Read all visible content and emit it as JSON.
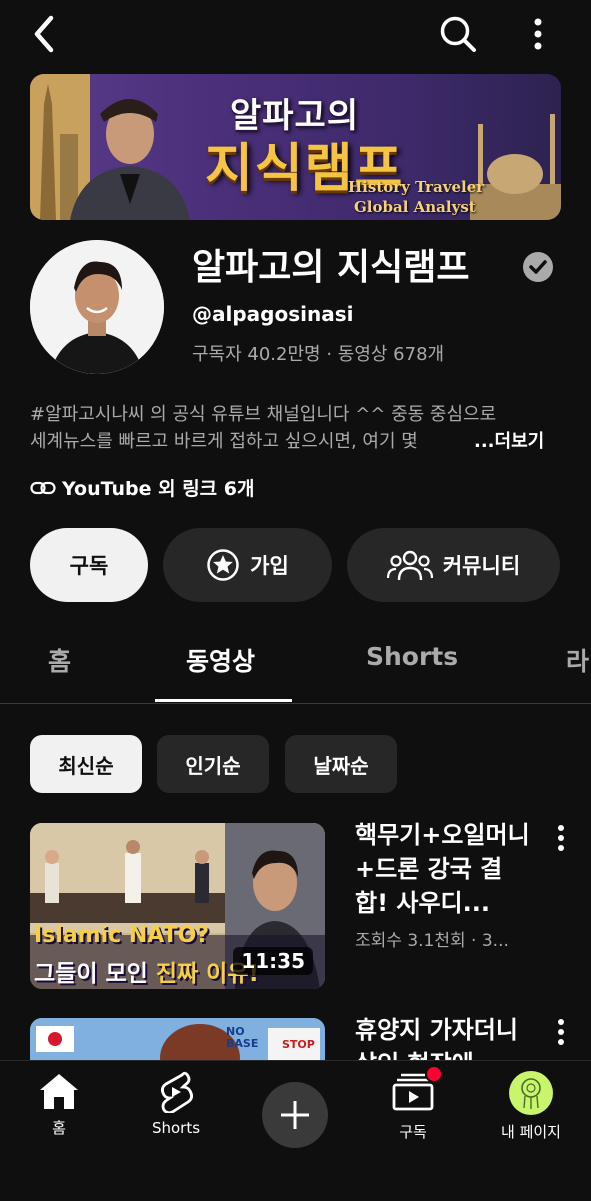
{
  "icons": {
    "back": "chevron-left-icon",
    "search": "search-icon",
    "more": "more-vert-icon",
    "verified": "verified-check-icon",
    "link": "link-icon",
    "join": "star-badge-icon",
    "community": "people-icon"
  },
  "banner": {
    "title_line1": "알파고의",
    "title_line2": "지식램프",
    "subtitle_line1": "History Traveler",
    "subtitle_line2": "Global Analyst"
  },
  "channel": {
    "name": "알파고의 지식램프",
    "handle": "@alpagosinasi",
    "stats": "구독자 40.2만명 · 동영상 678개",
    "description_line1": "#알파고시나씨 의 공식 유튜브 채널입니다 ^^ 중동 중심으로",
    "description_line2": "세계뉴스를 빠르고 바르게 접하고 싶으시면, 여기 몇",
    "more_label": "...더보기",
    "links_label": "YouTube 외 링크 6개"
  },
  "actions": {
    "subscribe": "구독",
    "join": "가입",
    "community": "커뮤니티"
  },
  "tabs": {
    "home": "홈",
    "videos": "동영상",
    "shorts": "Shorts",
    "live": "라"
  },
  "chips": {
    "latest": "최신순",
    "popular": "인기순",
    "oldest": "날짜순"
  },
  "videos": [
    {
      "title": "핵무기+오일머니+드론 강국 결합! 사우디...",
      "meta": "조회수 3.1천회 · 3...",
      "duration": "11:35",
      "thumb_text1": "Islamic NATO?",
      "thumb_text2a": "그들이 모인 ",
      "thumb_text2b": "진짜 이유!"
    },
    {
      "title": "휴양지 가자더니 살인 현장에...",
      "thumb_sign1": "NO BASE",
      "thumb_sign2": "STOP"
    }
  ],
  "bottom_nav": {
    "home": "홈",
    "shorts": "Shorts",
    "create": "plus-icon",
    "subscriptions": "구독",
    "me": "내 페이지"
  },
  "colors": {
    "background": "#0f0f0f",
    "chip_active": "#f1f1f1",
    "chip_inactive": "#272727",
    "notification_dot": "#ff0033",
    "banner_gold": "#f5c542"
  }
}
